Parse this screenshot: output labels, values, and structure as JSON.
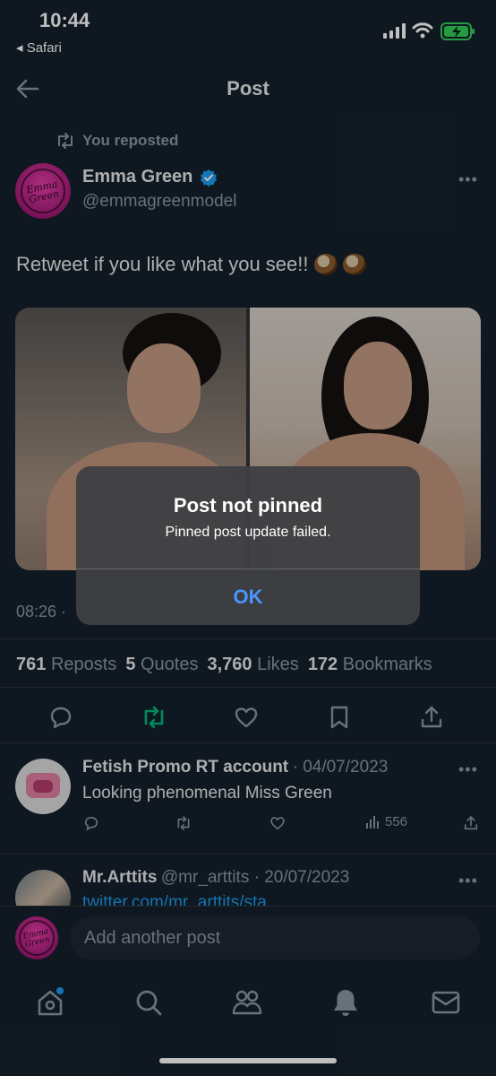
{
  "status_bar": {
    "time": "10:44",
    "back_app": "◂ Safari"
  },
  "header": {
    "title": "Post"
  },
  "tweet": {
    "repost_label": "You reposted",
    "author_name": "Emma Green",
    "author_handle": "@emmagreenmodel",
    "avatar_text": "Emma Green",
    "text": "Retweet if you like what you see!!",
    "timestamp": "08:26 ·",
    "stats": {
      "reposts_count": "761",
      "reposts_label": "Reposts",
      "quotes_count": "5",
      "quotes_label": "Quotes",
      "likes_count": "3,760",
      "likes_label": "Likes",
      "bookmarks_count": "172",
      "bookmarks_label": "Bookmarks"
    }
  },
  "replies": [
    {
      "name": "Fetish Promo RT account",
      "meta": "· 04/07/2023",
      "text": "Looking phenomenal Miss Green",
      "views": "556"
    },
    {
      "name": "Mr.Arttits",
      "meta": "@mr_arttits · 20/07/2023",
      "text": "twitter.com/mr_arttits/sta..."
    }
  ],
  "compose": {
    "placeholder": "Add another post"
  },
  "alert": {
    "title": "Post not pinned",
    "message": "Pinned post update failed.",
    "ok_label": "OK"
  },
  "colors": {
    "background": "#15202b",
    "accent": "#1d9bf0",
    "repost_active": "#00ba7c",
    "alert_button": "#4a95ff"
  }
}
